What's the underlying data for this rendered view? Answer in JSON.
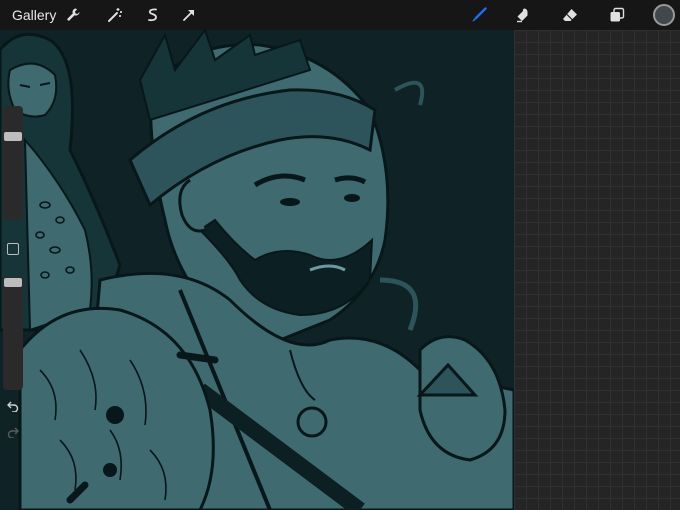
{
  "topbar": {
    "gallery_label": "Gallery",
    "left_tools": [
      "wrench-icon",
      "magic-wand-icon",
      "selection-icon",
      "transform-arrow-icon"
    ],
    "right_tools": [
      "brush-icon",
      "smudge-icon",
      "eraser-icon",
      "layers-icon"
    ],
    "active_tool": "brush",
    "active_color": "#41484d",
    "accent_color": "#1a6ef5"
  },
  "canvas": {
    "artwork": "illustration",
    "background_color": "#0f2326",
    "art_tone": "#3f6a70"
  },
  "sidebar": {
    "controls": [
      "brush-size-slider",
      "modify-button",
      "brush-opacity-slider",
      "undo-button",
      "redo-button"
    ]
  }
}
